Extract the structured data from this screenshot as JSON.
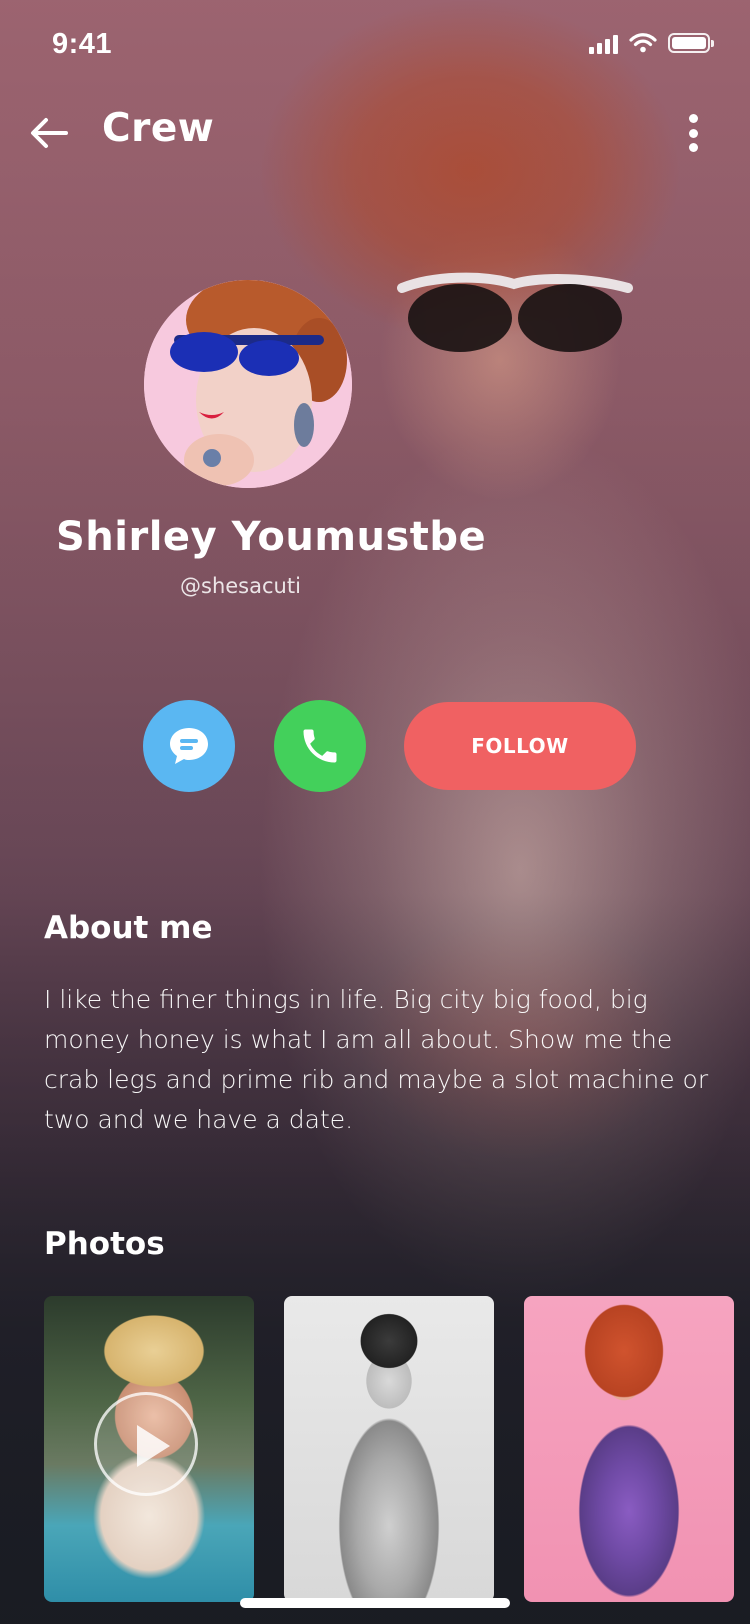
{
  "status_bar": {
    "time": "9:41",
    "icons": [
      "cellular-signal-icon",
      "wifi-icon",
      "battery-icon"
    ]
  },
  "nav": {
    "back_icon": "arrow-left-icon",
    "title": "Crew",
    "more_icon": "more-vertical-icon"
  },
  "profile": {
    "name": "Shirley Youmustbe",
    "handle": "@shesacuti",
    "avatar_icon": "avatar"
  },
  "actions": {
    "message_icon": "chat-bubble-icon",
    "call_icon": "phone-icon",
    "follow_label": "FOLLOW"
  },
  "colors": {
    "message": "#5ab7f2",
    "call": "#43d05b",
    "follow": "#f06162"
  },
  "about": {
    "title": "About me",
    "text": "I like the finer things in life. Big city big food, big money honey is what I am all about. Show me the crab legs and prime rib and maybe a slot machine or two and we have a date."
  },
  "photos": {
    "title": "Photos",
    "items": [
      {
        "type": "video"
      },
      {
        "type": "image"
      },
      {
        "type": "image"
      }
    ]
  }
}
